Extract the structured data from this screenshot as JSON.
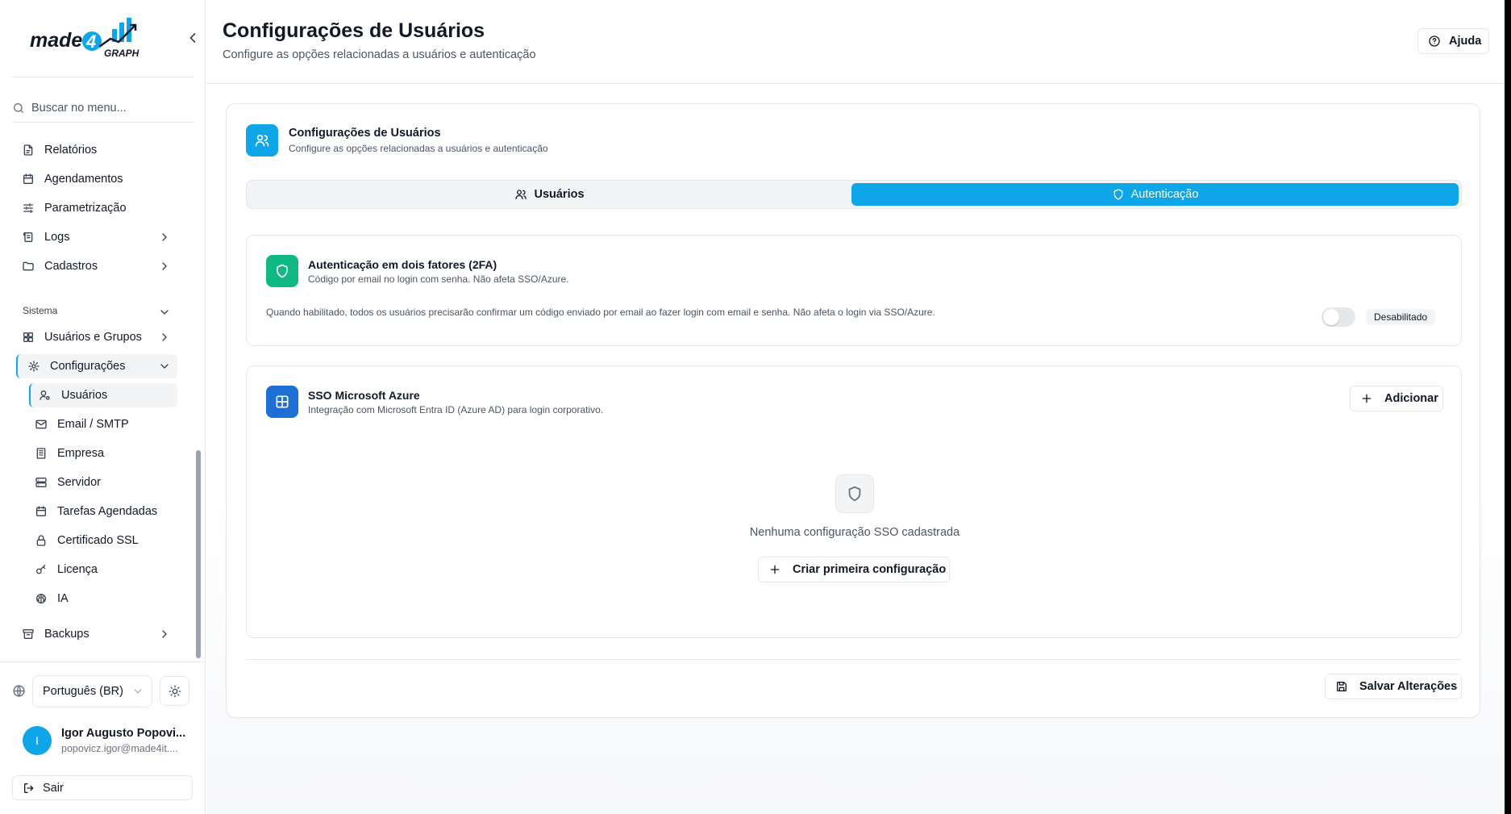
{
  "brand": {
    "name_part1": "made",
    "name_digit": "4",
    "name_part2": "GRAPH",
    "accent": "#0ea5e9"
  },
  "search": {
    "placeholder": "Buscar no menu..."
  },
  "nav": {
    "items": [
      {
        "label": "Relatórios",
        "icon": "file-report-icon"
      },
      {
        "label": "Agendamentos",
        "icon": "calendar-icon"
      },
      {
        "label": "Parametrização",
        "icon": "sliders-icon"
      },
      {
        "label": "Logs",
        "icon": "scroll-icon"
      },
      {
        "label": "Cadastros",
        "icon": "folder-icon"
      }
    ],
    "section_label": "Sistema",
    "system": {
      "users_groups": "Usuários e Grupos",
      "settings": "Configurações",
      "settings_children": [
        {
          "label": "Usuários",
          "icon": "user-cog-icon"
        },
        {
          "label": "Email / SMTP",
          "icon": "mail-icon"
        },
        {
          "label": "Empresa",
          "icon": "building-icon"
        },
        {
          "label": "Servidor",
          "icon": "server-icon"
        },
        {
          "label": "Tarefas Agendadas",
          "icon": "calendar-clock-icon"
        },
        {
          "label": "Certificado SSL",
          "icon": "lock-icon"
        },
        {
          "label": "Licença",
          "icon": "key-icon"
        },
        {
          "label": "IA",
          "icon": "brain-icon"
        }
      ],
      "backups": "Backups"
    }
  },
  "language": {
    "selected": "Português (BR)"
  },
  "user": {
    "initial": "I",
    "name": "Igor Augusto Popovi...",
    "email": "popovicz.igor@made4it...."
  },
  "logout_label": "Sair",
  "header": {
    "title": "Configurações de Usuários",
    "subtitle": "Configure as opções relacionadas a usuários e autenticação",
    "help_label": "Ajuda"
  },
  "card": {
    "title": "Configurações de Usuários",
    "subtitle": "Configure as opções relacionadas a usuários e autenticação",
    "tabs": [
      {
        "label": "Usuários",
        "active": false
      },
      {
        "label": "Autenticação",
        "active": true
      }
    ]
  },
  "twofa": {
    "title": "Autenticação em dois fatores (2FA)",
    "desc": "Código por email no login com senha. Não afeta SSO/Azure.",
    "note": "Quando habilitado, todos os usuários precisarão confirmar um código enviado por email ao fazer login com email e senha. Não afeta o login via SSO/Azure.",
    "enabled": false,
    "status_label": "Desabilitado",
    "icon_color": "#10b981"
  },
  "sso": {
    "title": "SSO Microsoft Azure",
    "desc": "Integração com Microsoft Entra ID (Azure AD) para login corporativo.",
    "add_label": "Adicionar",
    "empty_text": "Nenhuma configuração SSO cadastrada",
    "create_label": "Criar primeira configuração",
    "icon_color": "#1d6fd6"
  },
  "save_label": "Salvar Alterações"
}
